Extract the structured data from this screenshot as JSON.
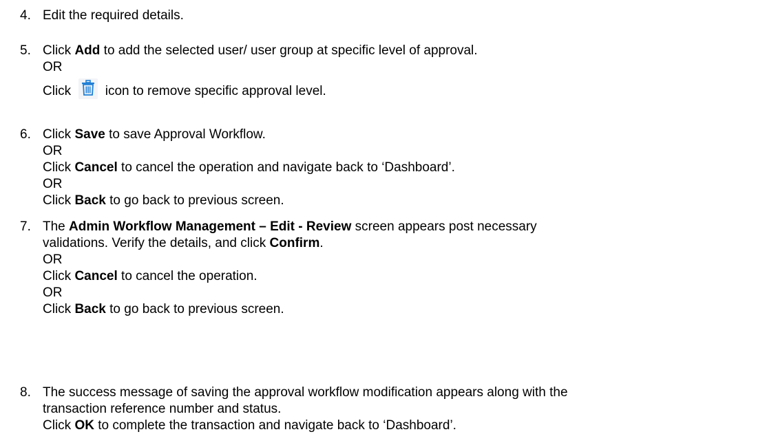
{
  "steps": [
    {
      "number": "4.",
      "lines": [
        {
          "segments": [
            {
              "t": "Edit the required details."
            }
          ]
        }
      ]
    },
    {
      "number": "5.",
      "lines": [
        {
          "segments": [
            {
              "t": "Click "
            },
            {
              "t": "Add",
              "b": true
            },
            {
              "t": " to add the selected user/ user group at specific level of approval."
            }
          ]
        },
        {
          "segments": [
            {
              "t": "OR"
            }
          ]
        },
        {
          "segments": [
            {
              "t": "Click "
            },
            {
              "icon": "trash-icon"
            },
            {
              "t": " icon to remove specific approval level."
            }
          ]
        }
      ]
    },
    {
      "number": "6.",
      "lines": [
        {
          "segments": [
            {
              "t": "Click "
            },
            {
              "t": "Save",
              "b": true
            },
            {
              "t": " to save Approval Workflow."
            }
          ]
        },
        {
          "segments": [
            {
              "t": "OR"
            }
          ]
        },
        {
          "segments": [
            {
              "t": "Click "
            },
            {
              "t": "Cancel",
              "b": true
            },
            {
              "t": " to cancel the operation and navigate back to ‘Dashboard’."
            }
          ]
        },
        {
          "segments": [
            {
              "t": "OR"
            }
          ]
        },
        {
          "segments": [
            {
              "t": "Click "
            },
            {
              "t": "Back",
              "b": true
            },
            {
              "t": " to go back to previous screen."
            }
          ]
        }
      ]
    },
    {
      "number": "7.",
      "lines": [
        {
          "segments": [
            {
              "t": "The "
            },
            {
              "t": "Admin Workflow Management – Edit - Review",
              "b": true
            },
            {
              "t": " screen appears post necessary"
            }
          ]
        },
        {
          "segments": [
            {
              "t": "validations. Verify the details, and click "
            },
            {
              "t": "Confirm",
              "b": true
            },
            {
              "t": "."
            }
          ]
        },
        {
          "segments": [
            {
              "t": "OR"
            }
          ]
        },
        {
          "segments": [
            {
              "t": "Click "
            },
            {
              "t": "Cancel",
              "b": true
            },
            {
              "t": " to cancel the operation."
            }
          ]
        },
        {
          "segments": [
            {
              "t": "OR"
            }
          ]
        },
        {
          "segments": [
            {
              "t": "Click "
            },
            {
              "t": "Back",
              "b": true
            },
            {
              "t": " to go back to previous screen."
            }
          ]
        }
      ]
    },
    {
      "number": "8.",
      "lines": [
        {
          "segments": [
            {
              "t": "The success message of saving the approval workflow modification appears along with the"
            }
          ]
        },
        {
          "segments": [
            {
              "t": "transaction reference number and status."
            }
          ]
        },
        {
          "segments": [
            {
              "t": "Click "
            },
            {
              "t": "OK",
              "b": true
            },
            {
              "t": " to complete the transaction and navigate back to ‘Dashboard’."
            }
          ]
        }
      ]
    }
  ],
  "colors": {
    "icon": "#1f7fd6",
    "text": "#000000"
  }
}
